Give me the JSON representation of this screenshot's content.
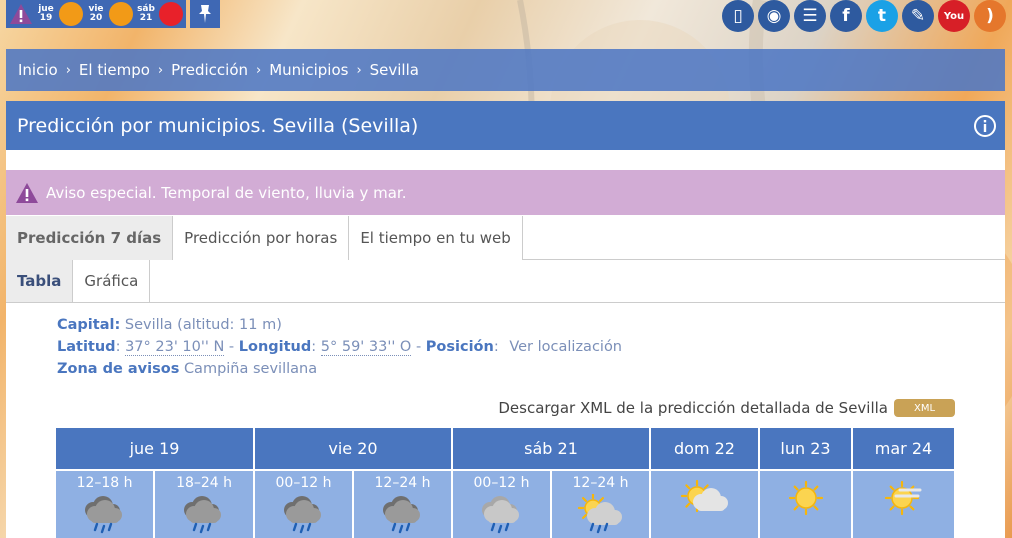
{
  "topbar": {
    "alerts": [
      {
        "label_day": "jue",
        "label_num": "19",
        "color": "#f29a17"
      },
      {
        "label_day": "vie",
        "label_num": "20",
        "color": "#f29a17"
      },
      {
        "label_day": "sáb",
        "label_num": "21",
        "color": "#e8212a"
      }
    ],
    "alert_color": "#3f68b4"
  },
  "social": [
    {
      "name": "mobile",
      "color": "#2e5a9f",
      "glyph": "▯"
    },
    {
      "name": "podcast",
      "color": "#2e5a9f",
      "glyph": "◉"
    },
    {
      "name": "list",
      "color": "#2e5a9f",
      "glyph": "☰"
    },
    {
      "name": "facebook",
      "color": "#2e5a9f",
      "glyph": "f"
    },
    {
      "name": "twitter",
      "color": "#1aa1e6",
      "glyph": "t"
    },
    {
      "name": "blog",
      "color": "#2e5a9f",
      "glyph": "✎"
    },
    {
      "name": "youtube",
      "color": "#d71f27",
      "glyph": "You"
    },
    {
      "name": "rss",
      "color": "#e5772c",
      "glyph": ")"
    }
  ],
  "breadcrumb": [
    "Inicio",
    "El tiempo",
    "Predicción",
    "Municipios",
    "Sevilla"
  ],
  "title": "Predicción por municipios. Sevilla (Sevilla)",
  "aviso": "Aviso especial. Temporal de viento, lluvia y mar.",
  "tabs_main": [
    "Predicción 7 días",
    "Predicción por horas",
    "El tiempo en tu web"
  ],
  "tabs_view": [
    "Tabla",
    "Gráfica"
  ],
  "meta": {
    "capital_label": "Capital:",
    "capital_value": "Sevilla (altitud: 11 m)",
    "lat_label": "Latitud",
    "lat_value": "37° 23' 10'' N",
    "lon_label": "Longitud",
    "lon_value": "5° 59' 33'' O",
    "pos_label": "Posición",
    "pos_value": "Ver localización",
    "zona_label": "Zona de avisos",
    "zona_value": "Campiña sevillana",
    "dash": "-"
  },
  "xml": {
    "text": "Descargar XML de la predicción detallada de Sevilla",
    "badge": "XML"
  },
  "forecast": {
    "days": [
      "jue 19",
      "vie 20",
      "sáb 21",
      "dom 22",
      "lun 23",
      "mar 24"
    ],
    "periods": [
      {
        "label": "12–18 h",
        "icon": "rain-storm"
      },
      {
        "label": "18–24 h",
        "icon": "rain-storm"
      },
      {
        "label": "00–12 h",
        "icon": "rain-storm"
      },
      {
        "label": "12–24 h",
        "icon": "rain-storm"
      },
      {
        "label": "00–12 h",
        "icon": "rain-light"
      },
      {
        "label": "12–24 h",
        "icon": "sun-rain"
      },
      {
        "label": "",
        "icon": "sun-cloud"
      },
      {
        "label": "",
        "icon": "sun"
      },
      {
        "label": "",
        "icon": "sun-haze"
      }
    ]
  }
}
